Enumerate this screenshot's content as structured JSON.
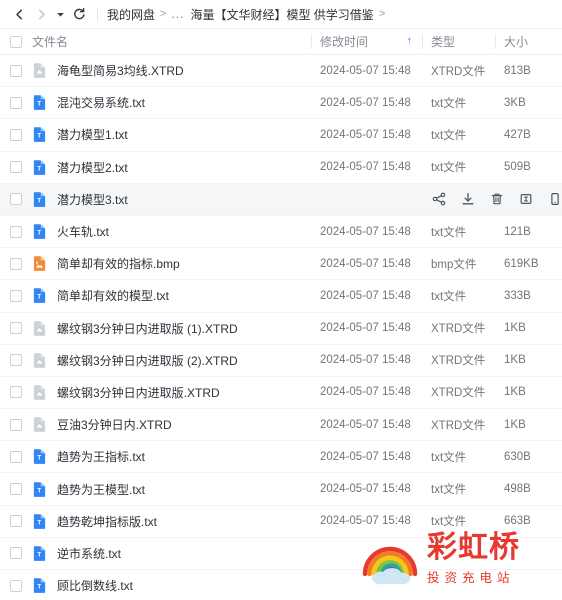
{
  "window": {
    "title": "我的网盘 - 海量【文华财经】模型 供学习借鉴"
  },
  "navbar": {
    "back_label": "后退",
    "forward_label": "前进",
    "history_label": "历史记录",
    "refresh_label": "刷新",
    "breadcrumb": {
      "root": "我的网盘",
      "ellipsis": "...",
      "current": "海量【文华财经】模型 供学习借鉴",
      "separator": ">"
    }
  },
  "columns": {
    "name": "文件名",
    "date": "修改时间",
    "type": "类型",
    "size": "大小",
    "sort": {
      "column": "date",
      "direction": "asc",
      "glyph": "↑",
      "color": "#2f86f6"
    }
  },
  "row_actions": [
    {
      "name": "share-icon",
      "label": "分享"
    },
    {
      "name": "download-icon",
      "label": "下载"
    },
    {
      "name": "delete-icon",
      "label": "删除"
    },
    {
      "name": "rename-icon",
      "label": "重命名"
    },
    {
      "name": "mobile-icon",
      "label": "手机查看"
    }
  ],
  "files": [
    {
      "name": "海龟型简易3均线.XTRD",
      "date": "2024-05-07 15:48",
      "type": "XTRD文件",
      "size": "813B",
      "icon": "xtrd",
      "hovered": false
    },
    {
      "name": "混沌交易系统.txt",
      "date": "2024-05-07 15:48",
      "type": "txt文件",
      "size": "3KB",
      "icon": "txt",
      "hovered": false
    },
    {
      "name": "潜力模型1.txt",
      "date": "2024-05-07 15:48",
      "type": "txt文件",
      "size": "427B",
      "icon": "txt",
      "hovered": false
    },
    {
      "name": "潜力模型2.txt",
      "date": "2024-05-07 15:48",
      "type": "txt文件",
      "size": "509B",
      "icon": "txt",
      "hovered": false
    },
    {
      "name": "潜力模型3.txt",
      "date": "",
      "type": "",
      "size": "",
      "icon": "txt",
      "hovered": true
    },
    {
      "name": "火车轨.txt",
      "date": "2024-05-07 15:48",
      "type": "txt文件",
      "size": "121B",
      "icon": "txt",
      "hovered": false
    },
    {
      "name": "简单却有效的指标.bmp",
      "date": "2024-05-07 15:48",
      "type": "bmp文件",
      "size": "619KB",
      "icon": "bmp",
      "hovered": false
    },
    {
      "name": "简单却有效的模型.txt",
      "date": "2024-05-07 15:48",
      "type": "txt文件",
      "size": "333B",
      "icon": "txt",
      "hovered": false
    },
    {
      "name": "螺纹钢3分钟日内进取版 (1).XTRD",
      "date": "2024-05-07 15:48",
      "type": "XTRD文件",
      "size": "1KB",
      "icon": "xtrd",
      "hovered": false
    },
    {
      "name": "螺纹钢3分钟日内进取版 (2).XTRD",
      "date": "2024-05-07 15:48",
      "type": "XTRD文件",
      "size": "1KB",
      "icon": "xtrd",
      "hovered": false
    },
    {
      "name": "螺纹钢3分钟日内进取版.XTRD",
      "date": "2024-05-07 15:48",
      "type": "XTRD文件",
      "size": "1KB",
      "icon": "xtrd",
      "hovered": false
    },
    {
      "name": "豆油3分钟日内.XTRD",
      "date": "2024-05-07 15:48",
      "type": "XTRD文件",
      "size": "1KB",
      "icon": "xtrd",
      "hovered": false
    },
    {
      "name": "趋势为王指标.txt",
      "date": "2024-05-07 15:48",
      "type": "txt文件",
      "size": "630B",
      "icon": "txt",
      "hovered": false
    },
    {
      "name": "趋势为王模型.txt",
      "date": "2024-05-07 15:48",
      "type": "txt文件",
      "size": "498B",
      "icon": "txt",
      "hovered": false
    },
    {
      "name": "趋势乾坤指标版.txt",
      "date": "2024-05-07 15:48",
      "type": "txt文件",
      "size": "663B",
      "icon": "txt",
      "hovered": false
    },
    {
      "name": "逆市系统.txt",
      "date": "",
      "type": "",
      "size": "",
      "icon": "txt",
      "hovered": false
    },
    {
      "name": "顾比倒数线.txt",
      "date": "",
      "type": "",
      "size": "",
      "icon": "txt",
      "hovered": false
    }
  ],
  "watermark": {
    "title": "彩虹桥",
    "subtitle": "投资充电站",
    "color": "#e8382f",
    "rainbow_colors": [
      "#e8382f",
      "#f07c23",
      "#f5c518",
      "#7fc241",
      "#26a69a",
      "#3f7fd0",
      "#8e44ad"
    ],
    "cloud_color": "#cfe7f5"
  },
  "colors": {
    "accent": "#2f86f6",
    "txt_icon": "#2f86f6",
    "bmp_icon": "#f08c3a",
    "xtrd_icon": "#c8ced4",
    "row_hover": "#f4f6f8",
    "text_primary": "#2e333a",
    "text_secondary": "#6f767e"
  }
}
